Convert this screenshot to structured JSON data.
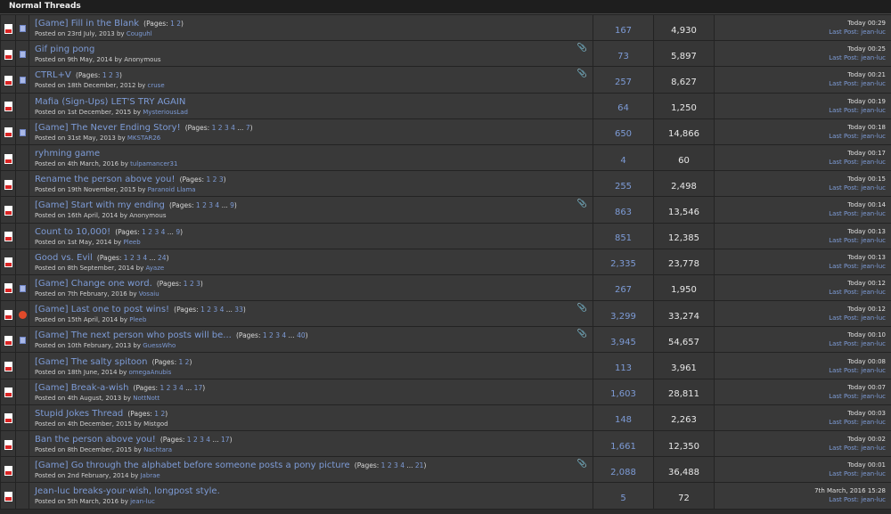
{
  "header": {
    "title": "Normal Threads"
  },
  "last_post_label": "Last Post:",
  "threads": [
    {
      "title": "[Game] Fill in the Blank",
      "pages": [
        "1",
        "2"
      ],
      "date": "23rd July, 2013",
      "author": "Couguhl",
      "replies": "167",
      "views": "4,930",
      "time": "Today 00:29",
      "last_user": "jean-luc",
      "attachment": false,
      "icon2": "mini-doc-icon"
    },
    {
      "title": "Gif ping pong",
      "pages": [],
      "date": "9th May, 2014",
      "author": "Anonymous",
      "author_plain": true,
      "replies": "73",
      "views": "5,897",
      "time": "Today 00:25",
      "last_user": "jean-luc",
      "attachment": true,
      "icon2": "mini-doc-icon"
    },
    {
      "title": "CTRL+V",
      "pages": [
        "1",
        "2",
        "3"
      ],
      "date": "18th December, 2012",
      "author": "cruse",
      "replies": "257",
      "views": "8,627",
      "time": "Today 00:21",
      "last_user": "jean-luc",
      "attachment": true,
      "icon2": "mini-doc-icon"
    },
    {
      "title": "Mafia (Sign-Ups) LET'S TRY AGAIN",
      "pages": [],
      "date": "1st December, 2015",
      "author": "MysteriousLad",
      "replies": "64",
      "views": "1,250",
      "time": "Today 00:19",
      "last_user": "jean-luc",
      "attachment": false,
      "icon2": ""
    },
    {
      "title": "[Game] The Never Ending Story!",
      "pages": [
        "1",
        "2",
        "3",
        "4",
        "...",
        "7"
      ],
      "date": "31st May, 2013",
      "author": "MKSTAR26",
      "replies": "650",
      "views": "14,866",
      "time": "Today 00:18",
      "last_user": "jean-luc",
      "attachment": false,
      "icon2": "mini-doc-icon"
    },
    {
      "title": "ryhming game",
      "pages": [],
      "date": "4th March, 2016",
      "author": "tulpamancer31",
      "replies": "4",
      "views": "60",
      "time": "Today 00:17",
      "last_user": "jean-luc",
      "attachment": false,
      "icon2": ""
    },
    {
      "title": "Rename the person above you!",
      "pages": [
        "1",
        "2",
        "3"
      ],
      "date": "19th November, 2015",
      "author": "Paranoid Llama",
      "replies": "255",
      "views": "2,498",
      "time": "Today 00:15",
      "last_user": "jean-luc",
      "attachment": false,
      "icon2": ""
    },
    {
      "title": "[Game] Start with my ending",
      "pages": [
        "1",
        "2",
        "3",
        "4",
        "...",
        "9"
      ],
      "date": "16th April, 2014",
      "author": "Anonymous",
      "author_plain": true,
      "replies": "863",
      "views": "13,546",
      "time": "Today 00:14",
      "last_user": "jean-luc",
      "attachment": true,
      "icon2": ""
    },
    {
      "title": "Count to 10,000!",
      "pages": [
        "1",
        "2",
        "3",
        "4",
        "...",
        "9"
      ],
      "date": "1st May, 2014",
      "author": "Pleeb",
      "replies": "851",
      "views": "12,385",
      "time": "Today 00:13",
      "last_user": "jean-luc",
      "attachment": false,
      "icon2": ""
    },
    {
      "title": "Good vs. Evil",
      "pages": [
        "1",
        "2",
        "3",
        "4",
        "...",
        "24"
      ],
      "date": "8th September, 2014",
      "author": "Ayaze",
      "replies": "2,335",
      "views": "23,778",
      "time": "Today 00:13",
      "last_user": "jean-luc",
      "attachment": false,
      "icon2": ""
    },
    {
      "title": "[Game] Change one word.",
      "pages": [
        "1",
        "2",
        "3"
      ],
      "date": "7th February, 2016",
      "author": "Vosaiu",
      "replies": "267",
      "views": "1,950",
      "time": "Today 00:12",
      "last_user": "jean-luc",
      "attachment": false,
      "icon2": "mini-doc-icon"
    },
    {
      "title": "[Game] Last one to post wins!",
      "pages": [
        "1",
        "2",
        "3",
        "4",
        "...",
        "33"
      ],
      "date": "15th April, 2014",
      "author": "Pleeb",
      "replies": "3,299",
      "views": "33,274",
      "time": "Today 00:12",
      "last_user": "jean-luc",
      "attachment": true,
      "icon2": "hot-icon"
    },
    {
      "title": "[Game] The next person who posts will be...",
      "pages": [
        "1",
        "2",
        "3",
        "4",
        "...",
        "40"
      ],
      "date": "10th February, 2013",
      "author": "GuessWho",
      "replies": "3,945",
      "views": "54,657",
      "time": "Today 00:10",
      "last_user": "jean-luc",
      "attachment": true,
      "icon2": "mini-doc-icon"
    },
    {
      "title": "[Game] The salty spitoon",
      "pages": [
        "1",
        "2"
      ],
      "date": "18th June, 2014",
      "author": "omegaAnubis",
      "replies": "113",
      "views": "3,961",
      "time": "Today 00:08",
      "last_user": "jean-luc",
      "attachment": false,
      "icon2": ""
    },
    {
      "title": "[Game] Break-a-wish",
      "pages": [
        "1",
        "2",
        "3",
        "4",
        "...",
        "17"
      ],
      "date": "4th August, 2013",
      "author": "NottNott",
      "replies": "1,603",
      "views": "28,811",
      "time": "Today 00:07",
      "last_user": "jean-luc",
      "attachment": false,
      "icon2": ""
    },
    {
      "title": "Stupid Jokes Thread",
      "pages": [
        "1",
        "2"
      ],
      "date": "4th December, 2015",
      "author": "Mistgod",
      "author_plain": true,
      "replies": "148",
      "views": "2,263",
      "time": "Today 00:03",
      "last_user": "jean-luc",
      "attachment": false,
      "icon2": ""
    },
    {
      "title": "Ban the person above you!",
      "pages": [
        "1",
        "2",
        "3",
        "4",
        "...",
        "17"
      ],
      "date": "8th December, 2015",
      "author": "Nachtara",
      "replies": "1,661",
      "views": "12,350",
      "time": "Today 00:02",
      "last_user": "jean-luc",
      "attachment": false,
      "icon2": ""
    },
    {
      "title": "[Game] Go through the alphabet before someone posts a pony picture",
      "pages": [
        "1",
        "2",
        "3",
        "4",
        "...",
        "21"
      ],
      "date": "2nd February, 2014",
      "author": "Jabrae",
      "replies": "2,088",
      "views": "36,488",
      "time": "Today 00:01",
      "last_user": "jean-luc",
      "attachment": true,
      "icon2": ""
    },
    {
      "title": "Jean-luc breaks-your-wish, longpost style.",
      "pages": [],
      "date": "5th March, 2016",
      "author": "jean-luc",
      "replies": "5",
      "views": "72",
      "time": "7th March, 2016 15:28",
      "last_user": "jean-luc",
      "attachment": false,
      "icon2": ""
    }
  ]
}
